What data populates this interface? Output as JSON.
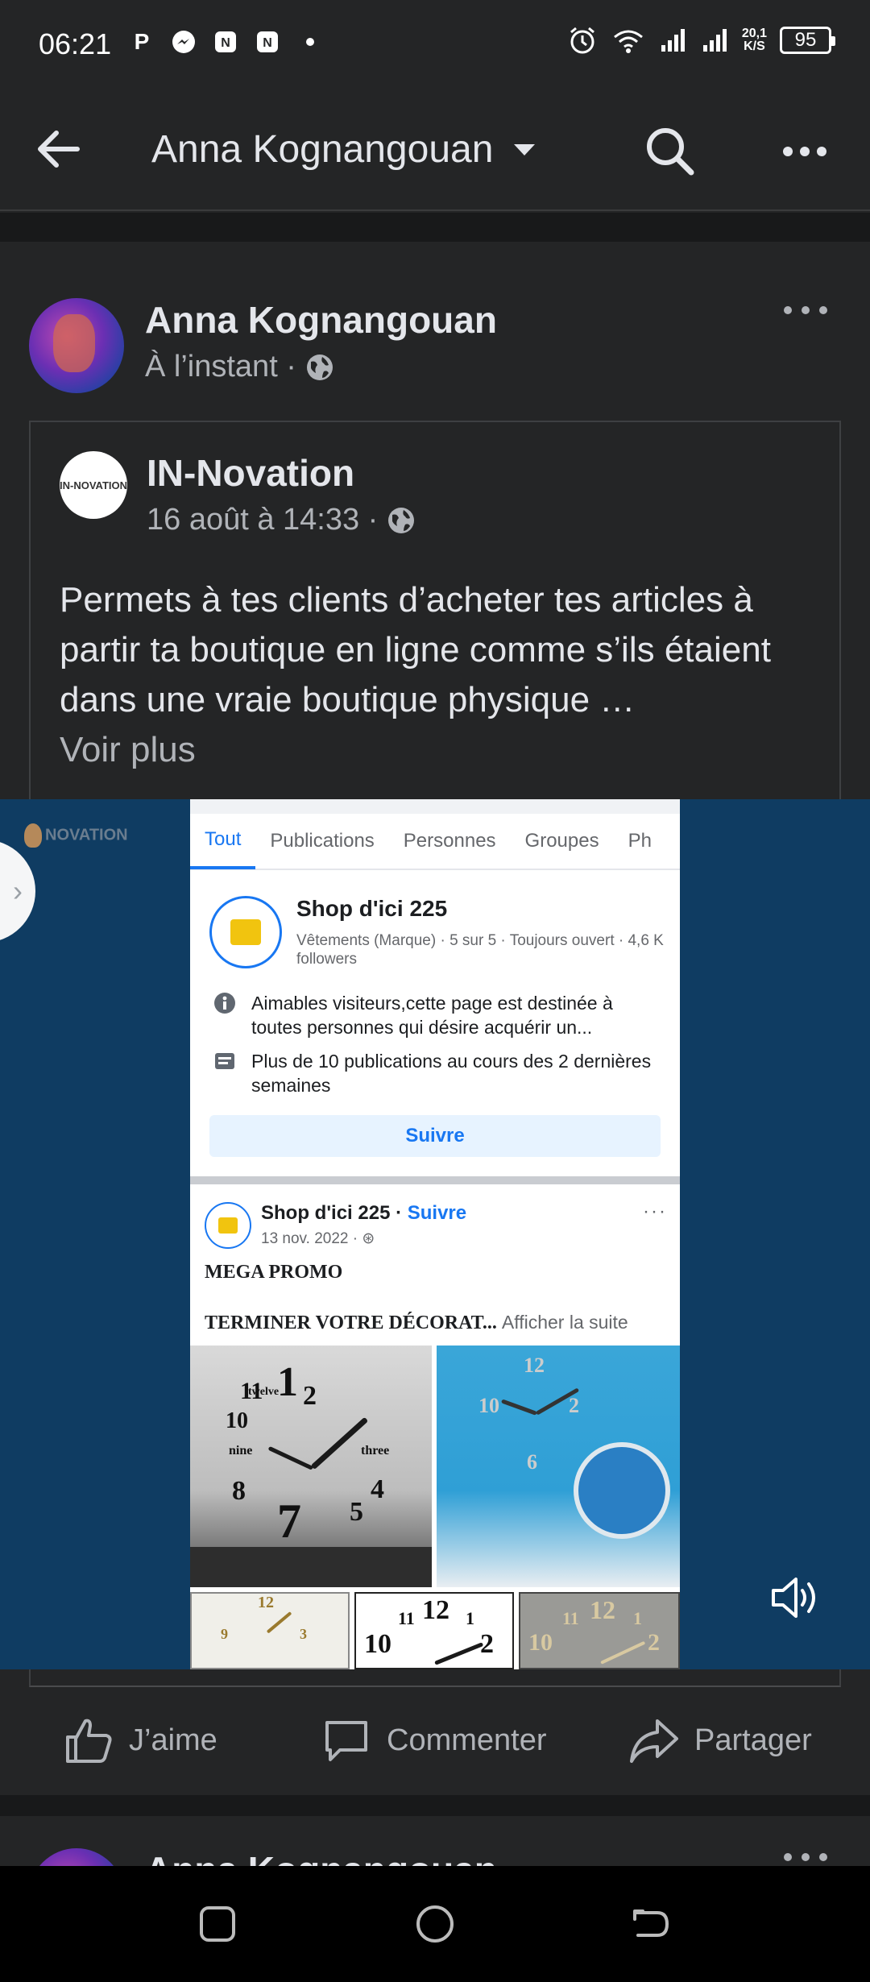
{
  "status_bar": {
    "time": "06:21",
    "network_speed_value": "20,1",
    "network_speed_unit": "K/S",
    "battery": "95",
    "icons": [
      "p-icon",
      "messenger-icon",
      "nfc-icon",
      "nfc-icon",
      "dot",
      "alarm-icon",
      "wifi-icon",
      "signal-icon",
      "signal-icon"
    ]
  },
  "app_bar": {
    "title": "Anna Kognangouan"
  },
  "post": {
    "author": "Anna Kognangouan",
    "time": "À l’instant ·",
    "shared": {
      "page_name": "IN-Novation",
      "page_logo_text": "IN-NOVATION",
      "date": "16 août à 14:33 ·",
      "text": "Permets à tes clients d’acheter tes articles à partir ta boutique en ligne comme s’ils étaient dans une vraie boutique physique …",
      "see_more": "Voir plus"
    }
  },
  "media": {
    "watermark": "NOVATION",
    "screen": {
      "tabs": [
        "Tout",
        "Publications",
        "Personnes",
        "Groupes",
        "Ph"
      ],
      "page_name": "Shop d'ici 225",
      "page_info": "Vêtements (Marque) · 5 sur 5 · Toujours ouvert · 4,6 K followers",
      "info_row_1": "Aimables visiteurs,cette page est destinée à toutes personnes qui désire acquérir un...",
      "info_row_2": "Plus de 10 publications au cours des 2 dernières semaines",
      "follow_button": "Suivre",
      "post_author": "Shop d'ici 225 ·",
      "post_follow": "Suivre",
      "post_date": "13 nov. 2022 ·",
      "post_dots": "···",
      "post_title": "MEGA PROMO",
      "post_line": "TERMINER VOTRE DÉCORAT...",
      "post_more": "Afficher la suite"
    }
  },
  "actions": {
    "like": "J’aime",
    "comment": "Commenter",
    "share": "Partager"
  },
  "next_post": {
    "author": "Anna Kognangouan"
  },
  "colors": {
    "background": "#242526",
    "separator": "#18191a",
    "text_primary": "#e4e6eb",
    "text_secondary": "#b0b3b8",
    "media_background": "#0f3c62",
    "link_blue": "#1877f2"
  }
}
